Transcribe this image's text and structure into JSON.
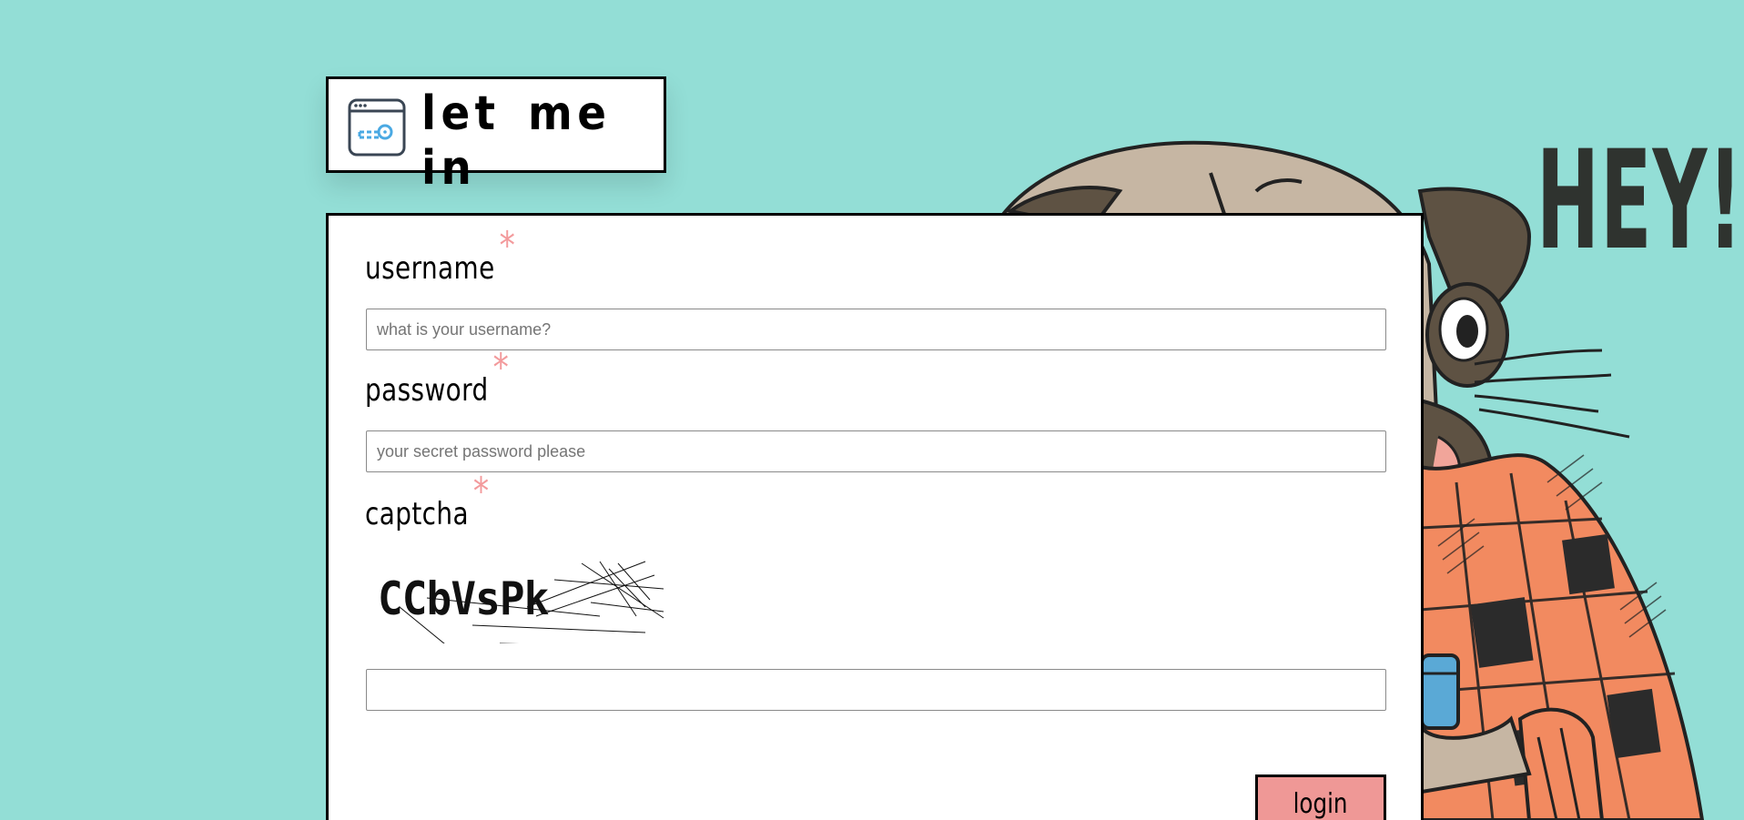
{
  "title": {
    "text": "let me in",
    "icon": "browser-key-icon"
  },
  "background": {
    "color": "#93ded6",
    "illustration": "pug-in-plaid-scarf",
    "shout": "HEY!"
  },
  "form": {
    "username": {
      "label": "username",
      "required_mark": "*",
      "placeholder": "what is your username?",
      "value": ""
    },
    "password": {
      "label": "password",
      "required_mark": "*",
      "placeholder": "your secret password please",
      "value": ""
    },
    "captcha": {
      "label": "captcha",
      "required_mark": "*",
      "image_text": "CCbVsPk",
      "input_value": "",
      "placeholder": ""
    },
    "submit_label": "login"
  },
  "colors": {
    "accent": "#ef9896",
    "required": "#f39a9c",
    "border": "#000000"
  }
}
